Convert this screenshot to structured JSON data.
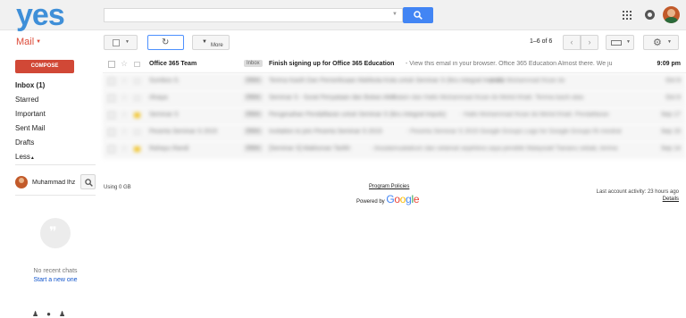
{
  "header": {
    "logo_text": "yes",
    "search": {
      "value": "",
      "placeholder": ""
    },
    "icons": [
      "search-icon",
      "apps-grid-icon",
      "notifications-icon",
      "account-avatar"
    ]
  },
  "toolbar": {
    "mail_label": "Mail",
    "more_label": "More",
    "pager_text": "1–6 of 6"
  },
  "sidebar": {
    "compose_label": "COMPOSE",
    "items": [
      {
        "label": "Inbox (1)"
      },
      {
        "label": "Starred"
      },
      {
        "label": "Important"
      },
      {
        "label": "Sent Mail"
      },
      {
        "label": "Drafts"
      },
      {
        "label": "Less"
      }
    ],
    "chat_user": "Muhammad Ihz",
    "no_chats": "No recent chats",
    "start_new": "Start a new one"
  },
  "messages": [
    {
      "sender": "Office 365 Team",
      "label": "Inbox",
      "subject": "Finish signing up for Office 365 Education",
      "snippet": " - View this email in your browser. Office 365 Education Almost there. We ju",
      "time": "9:09 pm",
      "unread": true
    },
    {
      "sender": "Sumbos S.",
      "label": "Inbox",
      "subject": "Terima Kasih Dan Pemeriksaan Mahkota Kota untuk Seminar S (Ikru integral Impuls)",
      "snippet": " - Hallo Muhammad Ihzan ibi",
      "time": "Oct 8",
      "unread": false
    },
    {
      "sender": "rilnaya",
      "label": "Inbox",
      "subject": "Seminar S - Surat Penyataan dan Bukan Akte",
      "snippet": " - Salam dan Hallo Muhammad Ihzan ibi Mohd Khatt. Terima kasih atas",
      "time": "Oct 6",
      "unread": false
    },
    {
      "sender": "Seminar S",
      "label": "Inbox",
      "subject": "Pengesahan Pendaftaran untuk Seminar S (ikru integral impuls)",
      "snippet": " - Hallo Muhammad Ihzan ibi Mohd Khatt. Pendaftaran",
      "time": "Sep 17",
      "unread": false
    },
    {
      "sender": "Peserta Seminar S 2015",
      "label": "Inbox",
      "subject": "Invitation to join Peserta Seminar S 2015",
      "snippet": " - Peserta Seminar S 2015 Google Groups Logo for Google Groups Ri mindrakn",
      "time": "Sep 15",
      "unread": false
    },
    {
      "sender": "Rahayu Randi",
      "label": "Inbox",
      "subject": "[Seminar S] Makluman Tarikh",
      "snippet": " - Assalamualaikum dan selamat sejahtera saya penditik Malaysiall Tiarianu sebab, terima",
      "time": "Sep 14",
      "unread": false
    }
  ],
  "footer": {
    "usage": "Using 0 GB",
    "policies": "Program Policies",
    "powered_by": "Powered by",
    "google_letters": [
      "G",
      "o",
      "o",
      "g",
      "l",
      "e"
    ],
    "last_activity": "Last account activity: 23 hours ago",
    "details": "Details"
  }
}
